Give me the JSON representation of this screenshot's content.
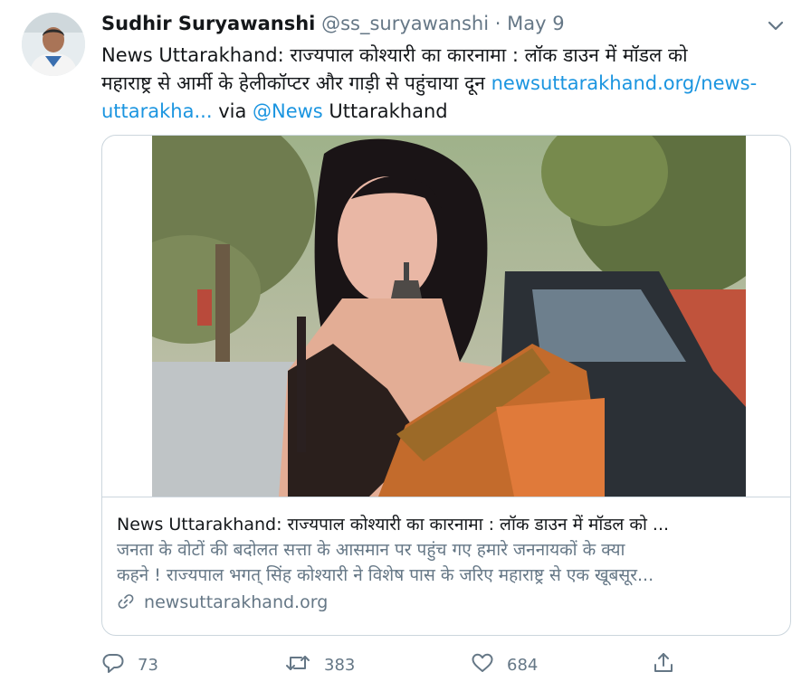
{
  "author": {
    "name": "Sudhir Suryawanshi",
    "handle": "@ss_suryawanshi",
    "separator": "·",
    "date": "May 9"
  },
  "tweet": {
    "text_line1": "News Uttarakhand: राज्यपाल कोश्यारी का कारनामा : लॉक डाउन में मॉडल को",
    "text_line2": "महाराष्ट्र से आर्मी के हेलीकॉप्टर और गाड़ी से पहुंचाया दून ",
    "link_part1": "newsuttarakhand.org/news-",
    "link_part2": "uttarakha...",
    "via": " via ",
    "mention": "@News",
    "after_mention": " Uttarakhand"
  },
  "card": {
    "title": "News Uttarakhand: राज्यपाल कोश्यारी का कारनामा : लॉक डाउन में मॉडल को ...",
    "desc_line1": "जनता के वोटों की बदोलत सत्ता के आसमान पर पहुंच गए हमारे जननायकों के क्या",
    "desc_line2": "कहने ! राज्यपाल भगत् सिंह कोश्यारी ने विशेष पास के जरिए महाराष्ट्र से एक खूबसूर...",
    "domain": "newsuttarakhand.org"
  },
  "actions": {
    "replies": "73",
    "retweets": "383",
    "likes": "684"
  },
  "icons": {
    "reply": "reply-icon",
    "retweet": "retweet-icon",
    "like": "heart-icon",
    "share": "share-icon",
    "link": "link-icon",
    "more": "chevron-down-icon"
  },
  "colors": {
    "link": "#1b95e0",
    "secondary": "#657786",
    "border": "#ccd6dd"
  }
}
